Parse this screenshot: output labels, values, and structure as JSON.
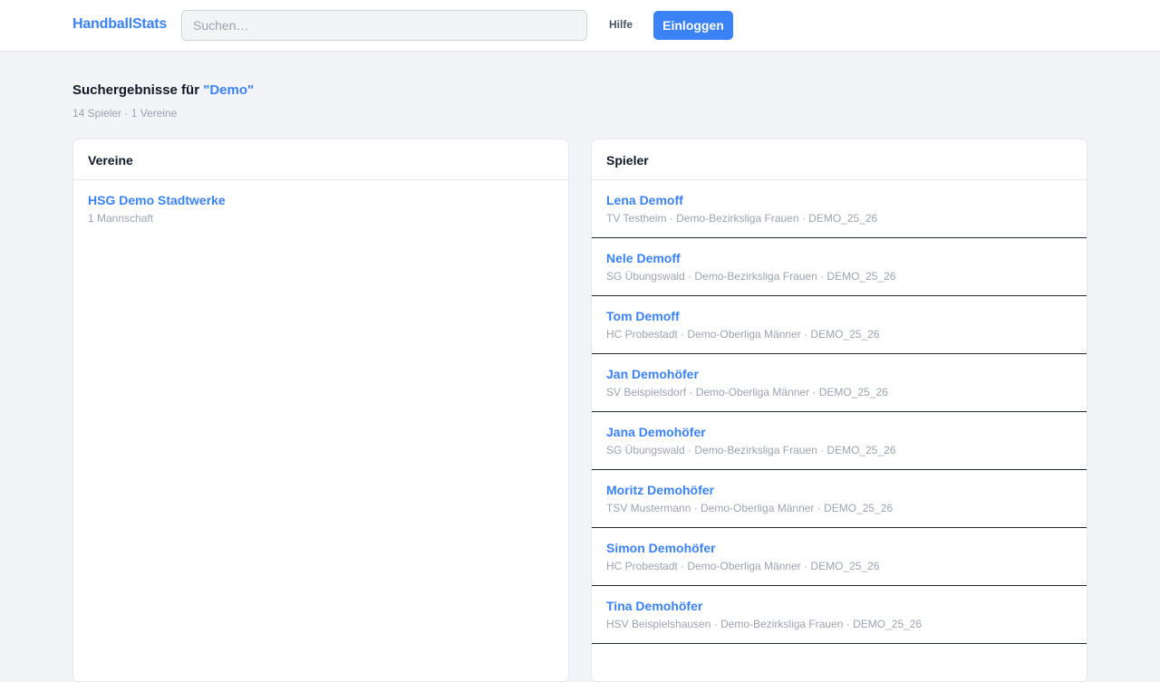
{
  "header": {
    "brand": "HandballStats",
    "search": {
      "placeholder": "Suchen…",
      "value": ""
    },
    "help_label": "Hilfe",
    "login_label": "Einloggen"
  },
  "results": {
    "title_prefix": "Suchergebnisse für ",
    "query": "\"Demo\"",
    "count": "14 Spieler · 1 Vereine"
  },
  "vereine": {
    "title": "Vereine",
    "items": [
      {
        "name": "HSG Demo Stadtwerke",
        "meta": "1 Mannschaft"
      }
    ]
  },
  "spieler": {
    "title": "Spieler",
    "items": [
      {
        "name": "Lena Demoff",
        "meta": "TV Testheim · Demo-Bezirksliga Frauen · DEMO_25_26"
      },
      {
        "name": "Nele Demoff",
        "meta": "SG Übungswald · Demo-Bezirksliga Frauen · DEMO_25_26"
      },
      {
        "name": "Tom Demoff",
        "meta": "HC Probestadt · Demo-Oberliga Männer · DEMO_25_26"
      },
      {
        "name": "Jan Demohöfer",
        "meta": "SV Beispielsdorf · Demo-Oberliga Männer · DEMO_25_26"
      },
      {
        "name": "Jana Demohöfer",
        "meta": "SG Übungswald · Demo-Bezirksliga Frauen · DEMO_25_26"
      },
      {
        "name": "Moritz Demohöfer",
        "meta": "TSV Mustermann · Demo-Oberliga Männer · DEMO_25_26"
      },
      {
        "name": "Simon Demohöfer",
        "meta": "HC Probestadt · Demo-Oberliga Männer · DEMO_25_26"
      },
      {
        "name": "Tina Demohöfer",
        "meta": "HSV Beispielshausen · Demo-Bezirksliga Frauen · DEMO_25_26"
      }
    ]
  },
  "colors": {
    "accent": "#3b82f6",
    "background": "#f3f4f7",
    "muted_text": "#9ca3af"
  }
}
